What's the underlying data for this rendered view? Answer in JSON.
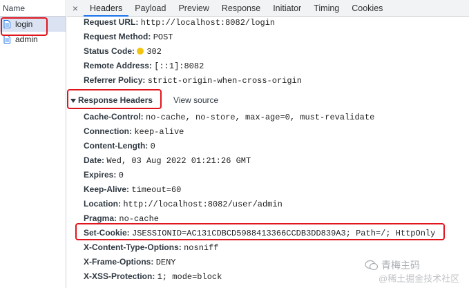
{
  "left_panel": {
    "header": "Name",
    "requests": [
      {
        "name": "login",
        "selected": true
      },
      {
        "name": "admin",
        "selected": false
      }
    ]
  },
  "tabs": {
    "close": "×",
    "items": [
      "Headers",
      "Payload",
      "Preview",
      "Response",
      "Initiator",
      "Timing",
      "Cookies"
    ],
    "active": "Headers"
  },
  "general": [
    {
      "key": "Request URL:",
      "value": "http://localhost:8082/login"
    },
    {
      "key": "Request Method:",
      "value": "POST"
    },
    {
      "key": "Status Code:",
      "value": "302"
    },
    {
      "key": "Remote Address:",
      "value": "[::1]:8082"
    },
    {
      "key": "Referrer Policy:",
      "value": "strict-origin-when-cross-origin"
    }
  ],
  "response_headers": {
    "title": "Response Headers",
    "view_source": "View source",
    "items": [
      {
        "key": "Cache-Control:",
        "value": "no-cache, no-store, max-age=0, must-revalidate"
      },
      {
        "key": "Connection:",
        "value": "keep-alive"
      },
      {
        "key": "Content-Length:",
        "value": "0"
      },
      {
        "key": "Date:",
        "value": "Wed, 03 Aug 2022 01:21:26 GMT"
      },
      {
        "key": "Expires:",
        "value": "0"
      },
      {
        "key": "Keep-Alive:",
        "value": "timeout=60"
      },
      {
        "key": "Location:",
        "value": "http://localhost:8082/user/admin"
      },
      {
        "key": "Pragma:",
        "value": "no-cache"
      },
      {
        "key": "Set-Cookie:",
        "value": "JSESSIONID=AC131CDBCD5988413366CCDB3DD839A3; Path=/; HttpOnly"
      },
      {
        "key": "X-Content-Type-Options:",
        "value": "nosniff"
      },
      {
        "key": "X-Frame-Options:",
        "value": "DENY"
      },
      {
        "key": "X-XSS-Protection:",
        "value": "1; mode=block"
      }
    ]
  },
  "watermark": {
    "line1": "青梅主码",
    "line2": "@稀土掘金技术社区"
  },
  "colors": {
    "highlight": "#e0141c",
    "selected_row": "#dbe3f3",
    "status_dot": "#f1c40f",
    "active_tab_underline": "#1a73e8"
  }
}
